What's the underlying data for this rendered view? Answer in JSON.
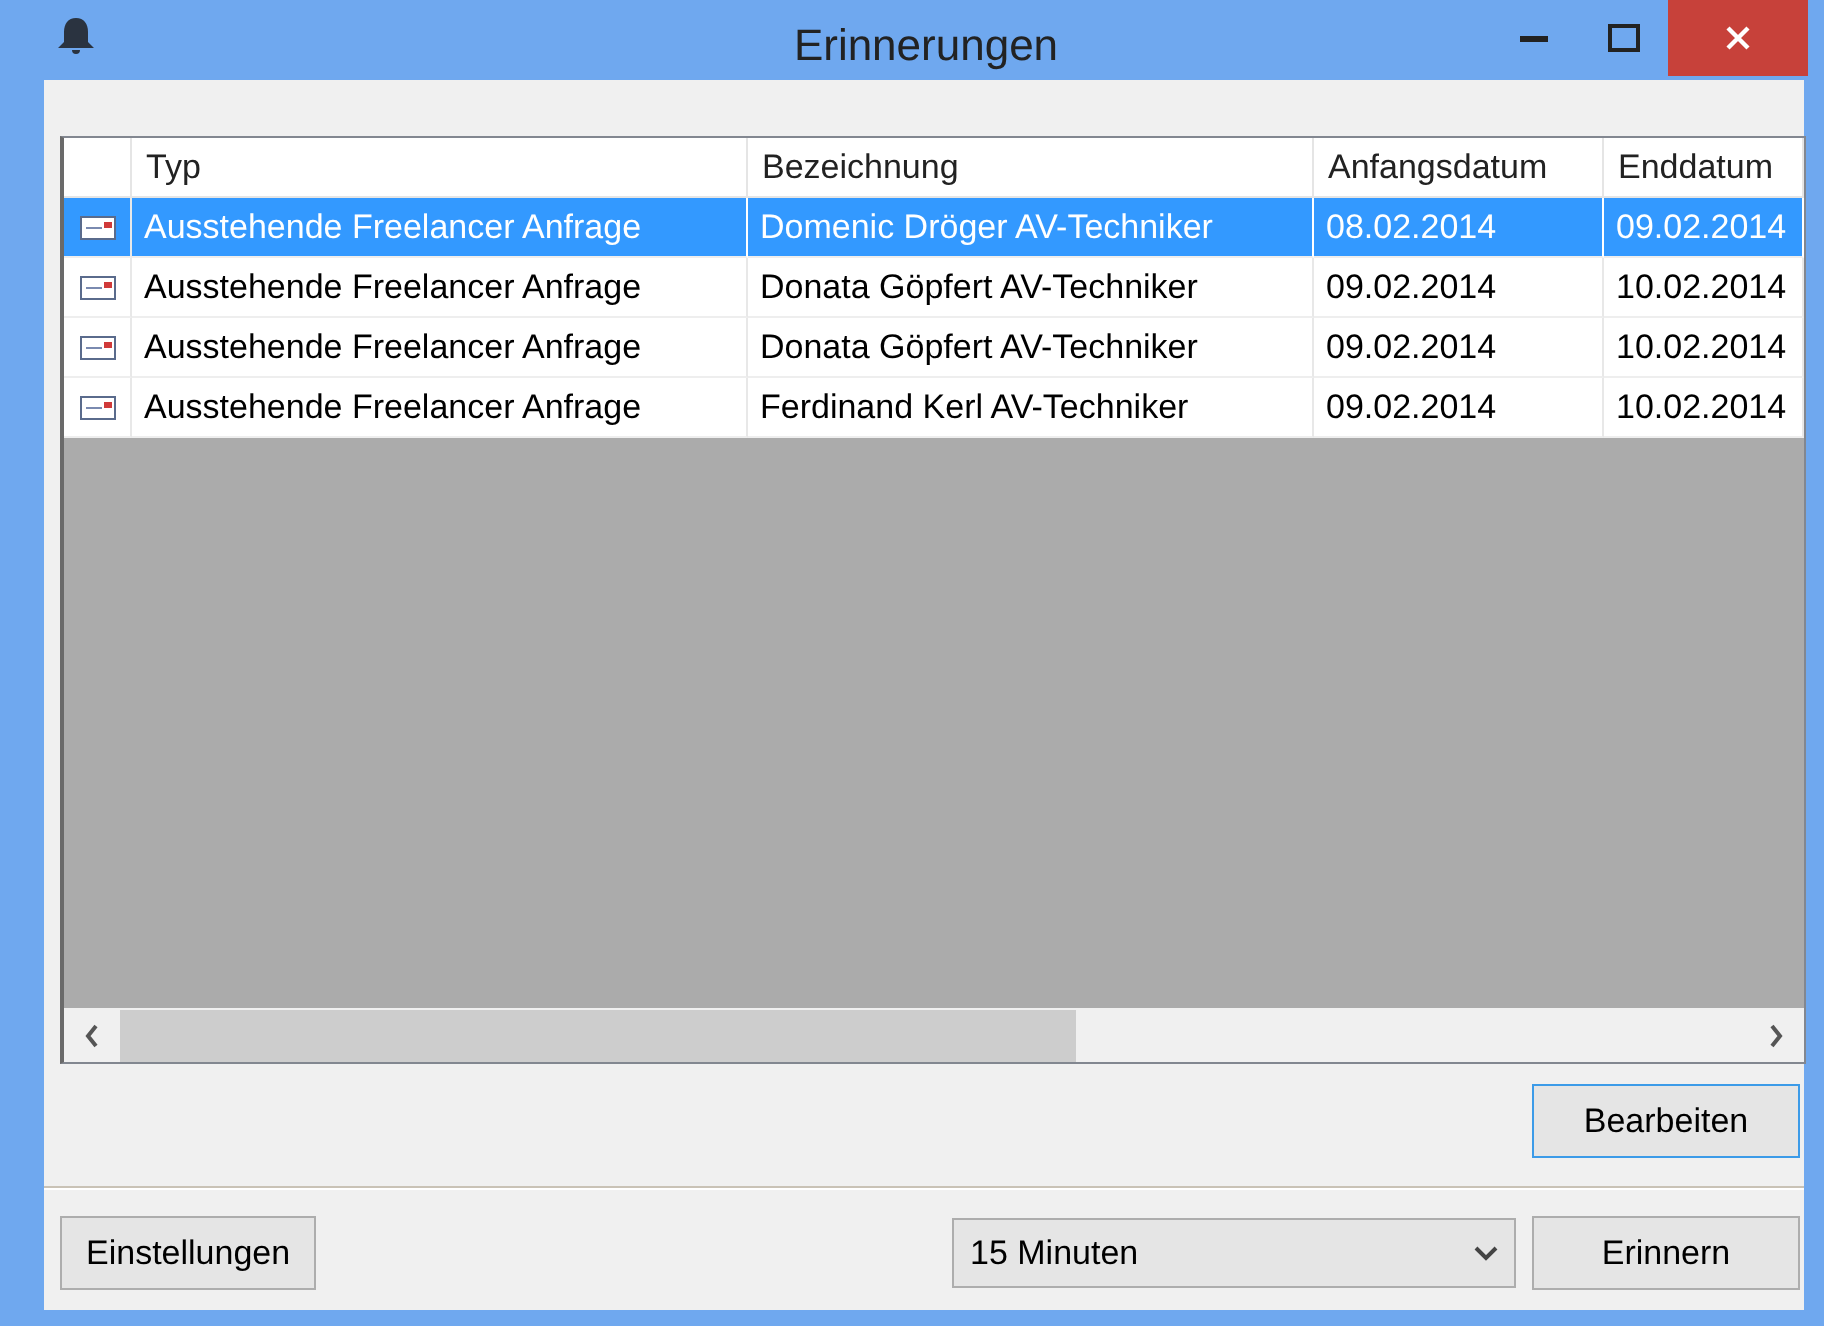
{
  "window": {
    "title": "Erinnerungen"
  },
  "table": {
    "columns": [
      "Typ",
      "Bezeichnung",
      "Anfangsdatum",
      "Enddatum"
    ],
    "rows": [
      {
        "selected": true,
        "cells": [
          "Ausstehende Freelancer Anfrage",
          "Domenic Dröger AV-Techniker",
          "08.02.2014",
          "09.02.2014"
        ]
      },
      {
        "selected": false,
        "cells": [
          "Ausstehende Freelancer Anfrage",
          "Donata Göpfert AV-Techniker",
          "09.02.2014",
          "10.02.2014"
        ]
      },
      {
        "selected": false,
        "cells": [
          "Ausstehende Freelancer Anfrage",
          "Donata Göpfert AV-Techniker",
          "09.02.2014",
          "10.02.2014"
        ]
      },
      {
        "selected": false,
        "cells": [
          "Ausstehende Freelancer Anfrage",
          "Ferdinand Kerl AV-Techniker",
          "09.02.2014",
          "10.02.2014"
        ]
      }
    ]
  },
  "edit_button": "Bearbeiten",
  "settings_button": "Einstellungen",
  "interval_select": "15 Minuten",
  "remind_button": "Erinnern"
}
